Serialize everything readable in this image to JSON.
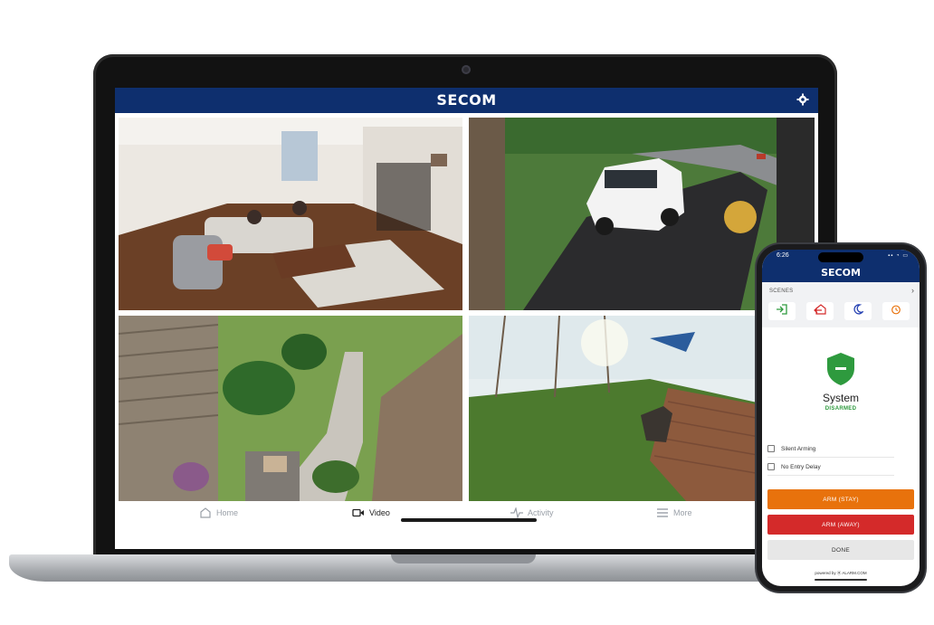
{
  "laptop_app": {
    "logo": "SECOM",
    "settings_icon": "gear-icon",
    "camera_feeds": [
      {
        "name": "living-room-camera"
      },
      {
        "name": "driveway-camera"
      },
      {
        "name": "front-entry-camera"
      },
      {
        "name": "backyard-camera"
      }
    ],
    "tabs": [
      {
        "label": "Home",
        "icon": "home-icon",
        "active": false
      },
      {
        "label": "Video",
        "icon": "video-icon",
        "active": true
      },
      {
        "label": "Activity",
        "icon": "activity-icon",
        "active": false
      },
      {
        "label": "More",
        "icon": "menu-icon",
        "active": false
      }
    ]
  },
  "phone_app": {
    "time": "6:26",
    "logo": "SECOM",
    "scenes": {
      "label": "SCENES",
      "buttons": [
        {
          "icon": "arrive-home-icon",
          "color": "#2e9a3e"
        },
        {
          "icon": "leave-home-icon",
          "color": "#d42a2a"
        },
        {
          "icon": "moon-icon",
          "color": "#2541b2"
        },
        {
          "icon": "alarm-clock-icon",
          "color": "#e8720c"
        }
      ]
    },
    "system": {
      "title": "System",
      "state": "DISARMED",
      "state_color": "#2e9a3e"
    },
    "options": [
      {
        "label": "Silent Arming",
        "checked": false
      },
      {
        "label": "No Entry Delay",
        "checked": false
      }
    ],
    "buttons": {
      "arm_stay": "ARM (STAY)",
      "arm_away": "ARM (AWAY)",
      "done": "DONE"
    },
    "powered_by": "powered by ⦿ ALARM.COM"
  },
  "colors": {
    "brand_navy": "#0e2f6e",
    "arm_stay": "#e8720c",
    "arm_away": "#d42a2a",
    "disarmed_green": "#2e9a3e"
  }
}
